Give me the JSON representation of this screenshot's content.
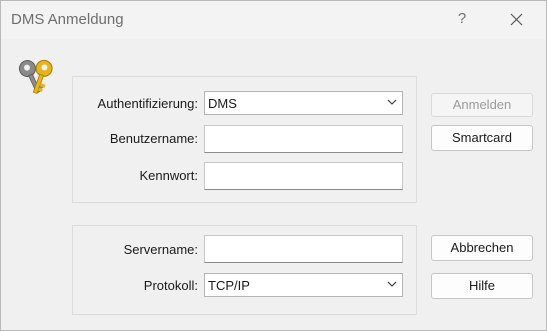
{
  "window": {
    "title": "DMS Anmeldung",
    "help_symbol": "?",
    "close_icon": "close-icon"
  },
  "icon": {
    "name": "keys-icon"
  },
  "auth_group": {
    "authentication_label": "Authentifizierung:",
    "authentication_value": "DMS",
    "username_label": "Benutzername:",
    "username_value": "",
    "password_label": "Kennwort:",
    "password_value": ""
  },
  "server_group": {
    "servername_label": "Servername:",
    "servername_value": "",
    "protocol_label": "Protokoll:",
    "protocol_value": "TCP/IP"
  },
  "buttons": {
    "login": "Anmelden",
    "smartcard": "Smartcard",
    "cancel": "Abbrechen",
    "help": "Hilfe"
  },
  "colors": {
    "background": "#f0f0f0",
    "key_gold": "#e8b417",
    "key_gray": "#8a8a8a"
  }
}
